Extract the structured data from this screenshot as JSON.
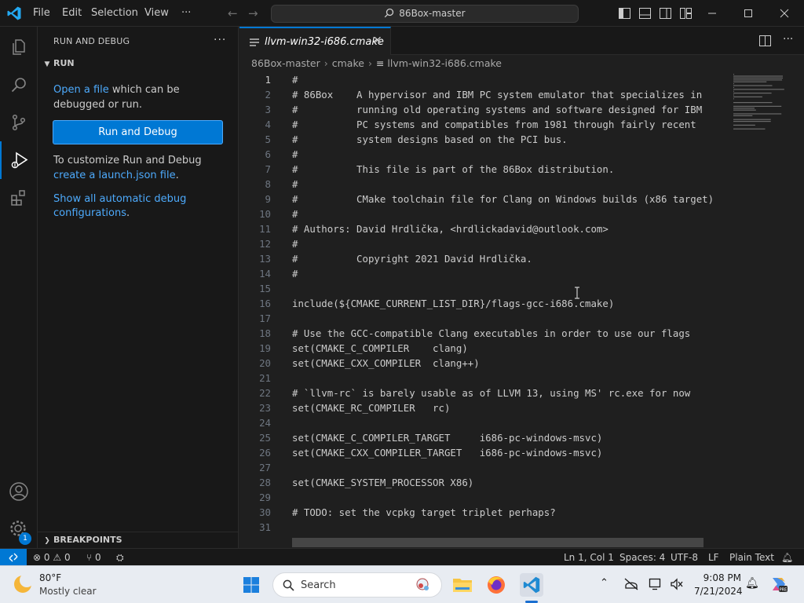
{
  "titlebar": {
    "menus": [
      "File",
      "Edit",
      "Selection",
      "View",
      "···"
    ],
    "command_center": "86Box-master"
  },
  "sidebar": {
    "title": "RUN AND DEBUG",
    "more": "···",
    "run_section": "RUN",
    "open_file_link": "Open a file",
    "open_file_rest": " which can be debugged or run.",
    "run_button": "Run and Debug",
    "customize_text": "To customize Run and Debug ",
    "customize_link": "create a launch.json file",
    "customize_end": ".",
    "show_all_link": "Show all automatic debug configurations",
    "show_all_end": ".",
    "breakpoints_section": "BREAKPOINTS",
    "manage_badge": "1"
  },
  "editor": {
    "tab_name": "llvm-win32-i686.cmake",
    "breadcrumb": [
      "86Box-master",
      "cmake",
      "llvm-win32-i686.cmake"
    ],
    "lines": [
      "#",
      "# 86Box    A hypervisor and IBM PC system emulator that specializes in",
      "#          running old operating systems and software designed for IBM",
      "#          PC systems and compatibles from 1981 through fairly recent",
      "#          system designs based on the PCI bus.",
      "#",
      "#          This file is part of the 86Box distribution.",
      "#",
      "#          CMake toolchain file for Clang on Windows builds (x86 target)",
      "#",
      "# Authors: David Hrdlička, <hrdlickadavid@outlook.com>",
      "#",
      "#          Copyright 2021 David Hrdlička.",
      "#",
      "",
      "include(${CMAKE_CURRENT_LIST_DIR}/flags-gcc-i686.cmake)",
      "",
      "# Use the GCC-compatible Clang executables in order to use our flags",
      "set(CMAKE_C_COMPILER    clang)",
      "set(CMAKE_CXX_COMPILER  clang++)",
      "",
      "# `llvm-rc` is barely usable as of LLVM 13, using MS' rc.exe for now",
      "set(CMAKE_RC_COMPILER   rc)",
      "",
      "set(CMAKE_C_COMPILER_TARGET     i686-pc-windows-msvc)",
      "set(CMAKE_CXX_COMPILER_TARGET   i686-pc-windows-msvc)",
      "",
      "set(CMAKE_SYSTEM_PROCESSOR X86)",
      "",
      "# TODO: set the vcpkg target triplet perhaps?",
      ""
    ]
  },
  "statusbar": {
    "errors": "0",
    "warnings": "0",
    "ports": "0",
    "position": "Ln 1, Col 1",
    "spaces": "Spaces: 4",
    "encoding": "UTF-8",
    "eol": "LF",
    "language": "Plain Text"
  },
  "taskbar": {
    "weather_temp": "80°F",
    "weather_desc": "Mostly clear",
    "search": "Search",
    "time": "9:08 PM",
    "date": "7/21/2024"
  },
  "colors": {
    "accent": "#0078d4",
    "link": "#4daafc",
    "background": "#1f1f1f",
    "panel": "#181818"
  },
  "icons": [
    "vscode-logo",
    "explorer-icon",
    "search-icon",
    "source-control-icon",
    "run-debug-icon",
    "extensions-icon",
    "account-icon",
    "manage-gear-icon",
    "split-editor-icon",
    "more-actions-icon",
    "remote-icon",
    "error-icon",
    "warning-icon",
    "ports-icon",
    "bell-icon",
    "windows-start-icon",
    "file-explorer-icon",
    "firefox-icon",
    "vscode-taskbar-icon",
    "chevron-up-icon",
    "network-icon",
    "copilot-icon"
  ]
}
